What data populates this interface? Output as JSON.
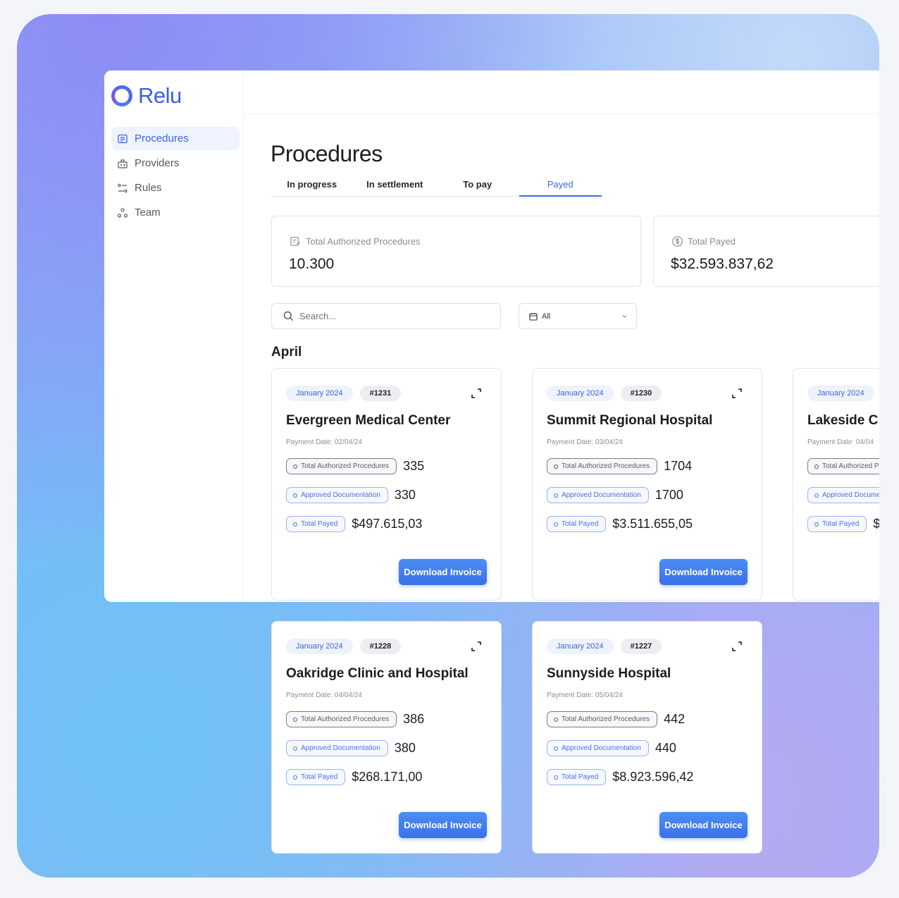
{
  "app": {
    "logo_text": "Relu",
    "nav": [
      {
        "label": "Procedures",
        "icon": "procedures-icon",
        "active": true
      },
      {
        "label": "Providers",
        "icon": "providers-icon",
        "active": false
      },
      {
        "label": "Rules",
        "icon": "rules-icon",
        "active": false
      },
      {
        "label": "Team",
        "icon": "team-icon",
        "active": false
      }
    ]
  },
  "page": {
    "title": "Procedures",
    "tabs": [
      "In progress",
      "In settlement",
      "To pay",
      "Payed"
    ],
    "active_tab": "Payed"
  },
  "stats": {
    "authorized": {
      "label": "Total Authorized Procedures",
      "value": "10.300"
    },
    "payed": {
      "label": "Total Payed",
      "value": "$32.593.837,62"
    }
  },
  "filters": {
    "search_placeholder": "Search...",
    "select_value": "All"
  },
  "section_label": "April",
  "card_labels": {
    "authorized": "Total Authorized Procedures",
    "approved": "Approved Documentation",
    "payed": "Total Payed",
    "button": "Download Invoice",
    "payment_date_prefix": "Payment Date: "
  },
  "cards": [
    {
      "period": "January 2024",
      "id": "#1231",
      "name": "Evergreen Medical Center",
      "payment_date": "Payment Date: 02/04/24",
      "authorized": "335",
      "approved": "330",
      "payed": "$497.615,03"
    },
    {
      "period": "January 2024",
      "id": "#1230",
      "name": "Summit Regional Hospital",
      "payment_date": "Payment Date: 03/04/24",
      "authorized": "1704",
      "approved": "1700",
      "payed": "$3.511.655,05"
    },
    {
      "period": "January 2024",
      "id": "",
      "name": "Lakeside C",
      "payment_date": "Payment Date: 04/04",
      "authorized": "",
      "approved": "",
      "payed": "$"
    },
    {
      "period": "January 2024",
      "id": "#1228",
      "name": "Oakridge Clinic and Hospital",
      "payment_date": "Payment Date: 04/04/24",
      "authorized": "386",
      "approved": "380",
      "payed": "$268.171,00"
    },
    {
      "period": "January 2024",
      "id": "#1227",
      "name": "Sunnyside Hospital",
      "payment_date": "Payment Date: 05/04/24",
      "authorized": "442",
      "approved": "440",
      "payed": "$8.923.596,42"
    }
  ],
  "colors": {
    "accent": "#3e6ae6",
    "button": "#3a71ea",
    "tag_blue": "#4a74e5",
    "tag_grey": "#5c5e65"
  }
}
